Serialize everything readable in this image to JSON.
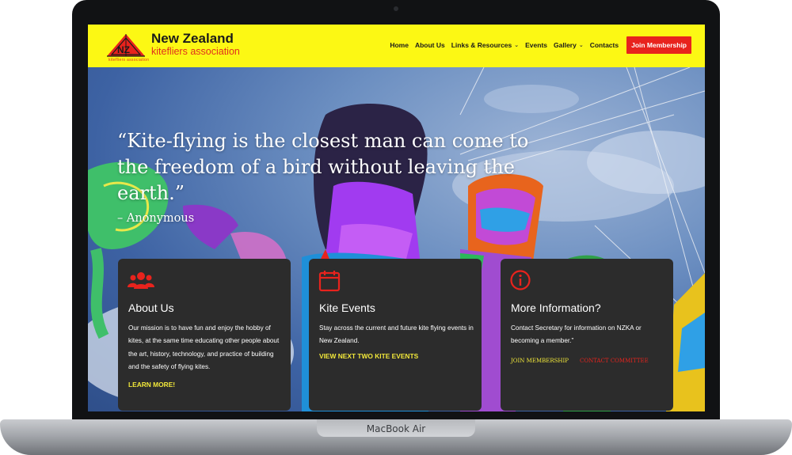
{
  "device": {
    "label": "MacBook Air"
  },
  "brand": {
    "mark_text": "NZ",
    "small_text": "kitefliers association",
    "name": "New Zealand",
    "subtitle": "kitefliers association",
    "colors": {
      "header_bg": "#fcf814",
      "accent_red": "#e8231d",
      "link_yellow": "#f2e83a"
    }
  },
  "nav": {
    "items": [
      {
        "label": "Home",
        "has_dropdown": false
      },
      {
        "label": "About Us",
        "has_dropdown": false
      },
      {
        "label": "Links & Resources",
        "has_dropdown": true
      },
      {
        "label": "Events",
        "has_dropdown": false
      },
      {
        "label": "Gallery",
        "has_dropdown": true
      },
      {
        "label": "Contacts",
        "has_dropdown": false
      }
    ],
    "cta": "Join Membership"
  },
  "hero": {
    "quote": "“Kite-flying is the closest man can come to the freedom of a bird without leaving the earth.”",
    "author": "– Anonymous"
  },
  "cards": [
    {
      "icon": "users-icon",
      "title": "About Us",
      "text": "Our mission is to have fun and enjoy the hobby of kites, at the same time educating other people about the art, history, technology, and practice of building and the safety of flying kites.",
      "link": "LEARN MORE!"
    },
    {
      "icon": "calendar-icon",
      "title": "Kite Events",
      "text": "Stay across the current and future kite flying events in New Zealand.",
      "link": "VIEW NEXT TWO KITE EVENTS"
    },
    {
      "icon": "info-icon",
      "title": "More Information?",
      "text": "Contact Secretary for information on NZKA or becoming a member.”",
      "links": [
        {
          "label": "JOIN MEMBERSHIP",
          "color": "#f2e83a"
        },
        {
          "label": "CONTACT COMMITTEE",
          "color": "#e8231d"
        }
      ]
    }
  ]
}
